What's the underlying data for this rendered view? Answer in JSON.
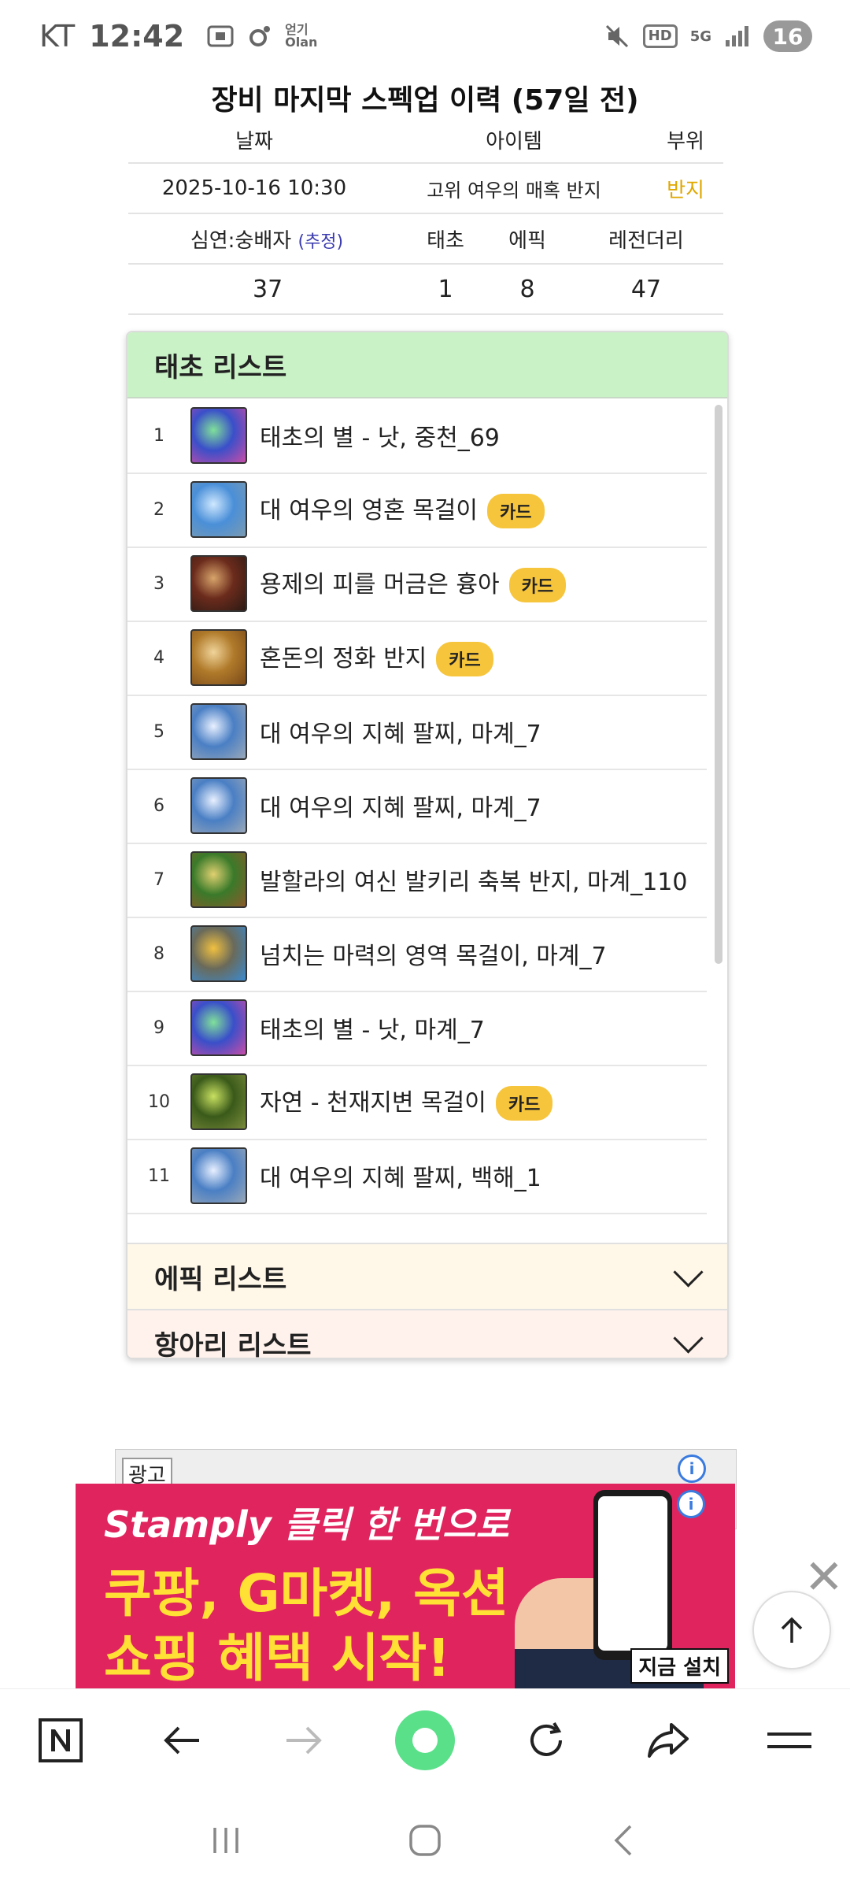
{
  "status_bar": {
    "carrier": "KT",
    "time": "12:42",
    "app_hint": "얻기\nOlan",
    "net": "5G",
    "hd": "HD",
    "battery": "16"
  },
  "page_title": "장비 마지막 스펙업 이력 (57일 전)",
  "spec_table": {
    "headers": [
      "날짜",
      "아이템",
      "부위"
    ],
    "row": {
      "date": "2025-10-16 10:30",
      "item": "고위 여우의 매혹 반지",
      "slot": "반지"
    },
    "stats_headers": {
      "abyss_label": "심연:숭배자",
      "abyss_note": "(추정)",
      "taecho": "태초",
      "epic": "에픽",
      "legendary": "레전더리"
    },
    "stats_values": {
      "abyss": "37",
      "taecho": "1",
      "epic": "8",
      "legendary": "47"
    }
  },
  "taecho_list": {
    "title": "태초 리스트",
    "items": [
      {
        "no": "1",
        "name": "태초의 별 - 낫, 중천_69",
        "badge": ""
      },
      {
        "no": "2",
        "name": "대 여우의 영혼 목걸이",
        "badge": "카드"
      },
      {
        "no": "3",
        "name": "용제의 피를 머금은 흉아",
        "badge": "카드"
      },
      {
        "no": "4",
        "name": "혼돈의 정화 반지",
        "badge": "카드"
      },
      {
        "no": "5",
        "name": "대 여우의 지혜 팔찌, 마계_7",
        "badge": ""
      },
      {
        "no": "6",
        "name": "대 여우의 지혜 팔찌, 마계_7",
        "badge": ""
      },
      {
        "no": "7",
        "name": "발할라의 여신 발키리 축복 반지, 마계_110",
        "badge": ""
      },
      {
        "no": "8",
        "name": "넘치는 마력의 영역 목걸이, 마계_7",
        "badge": ""
      },
      {
        "no": "9",
        "name": "태초의 별 - 낫, 마계_7",
        "badge": ""
      },
      {
        "no": "10",
        "name": "자연 - 천재지변 목걸이",
        "badge": "카드"
      },
      {
        "no": "11",
        "name": "대 여우의 지혜 팔찌, 백해_1",
        "badge": ""
      }
    ]
  },
  "epic_list": {
    "title": "에픽 리스트"
  },
  "jar_list": {
    "title": "항아리 리스트"
  },
  "ad": {
    "label": "광고",
    "line1": "Stamply 클릭 한 번으로",
    "line2": "쿠팡, G마켓, 옥션",
    "line3": "쇼핑 혜택 시작!",
    "install": "지금 설치"
  },
  "colors": {
    "taecho_header": "#c9f2c6",
    "epic_header": "#fff8e9",
    "jar_header": "#fff1eb",
    "badge": "#f6c53c",
    "slot": "#e0a800",
    "ad_bg": "#e0245e"
  }
}
